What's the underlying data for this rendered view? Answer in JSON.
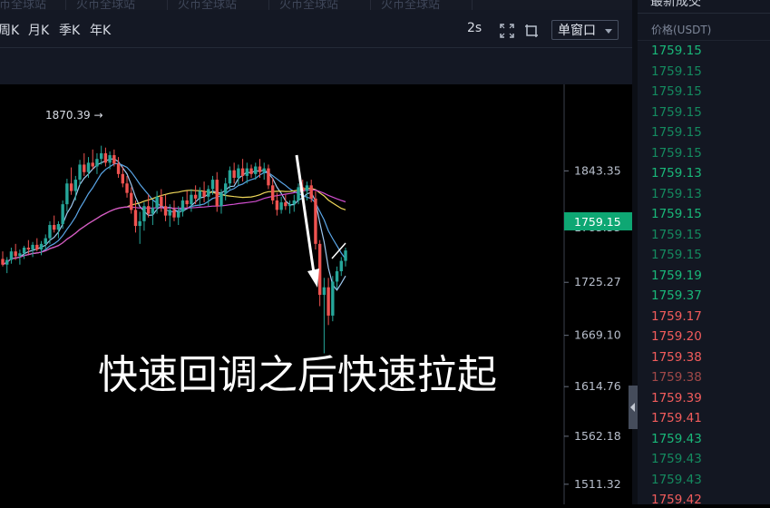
{
  "top_tabs": [
    "火币全球站",
    "火币全球站",
    "火币全球站",
    "火币全球站",
    "火币全球站"
  ],
  "toolbar": {
    "periods": [
      "周K",
      "月K",
      "季K",
      "年K"
    ],
    "interval": "2s",
    "window_select": "单窗口"
  },
  "chart": {
    "overlay_text": "快速回调之后快速拉起",
    "high_marker": "1870.39",
    "current_price": "1759.15",
    "y_ticks": [
      "1843.35",
      "1783.33",
      "1725.27",
      "1669.10",
      "1614.76",
      "1562.18",
      "1511.32"
    ]
  },
  "chart_data": {
    "type": "candlestick",
    "y_ticks": [
      1843.35,
      1783.33,
      1725.27,
      1669.1,
      1614.76,
      1562.18,
      1511.32
    ],
    "ylim": [
      1490,
      1935
    ],
    "high_label": 1870.39,
    "last_price": 1759.15,
    "up_color": "#26a69a",
    "down_color": "#ef5350",
    "candles": [
      [
        1750,
        1758,
        1742,
        1744
      ],
      [
        1744,
        1752,
        1735,
        1749
      ],
      [
        1749,
        1762,
        1745,
        1758
      ],
      [
        1758,
        1766,
        1749,
        1753
      ],
      [
        1753,
        1760,
        1744,
        1756
      ],
      [
        1756,
        1764,
        1750,
        1762
      ],
      [
        1762,
        1770,
        1755,
        1760
      ],
      [
        1760,
        1768,
        1752,
        1765
      ],
      [
        1765,
        1772,
        1758,
        1760
      ],
      [
        1760,
        1769,
        1754,
        1766
      ],
      [
        1766,
        1776,
        1760,
        1772
      ],
      [
        1772,
        1790,
        1766,
        1786
      ],
      [
        1786,
        1796,
        1778,
        1781
      ],
      [
        1781,
        1790,
        1772,
        1787
      ],
      [
        1787,
        1812,
        1782,
        1808
      ],
      [
        1808,
        1835,
        1800,
        1830
      ],
      [
        1830,
        1847,
        1818,
        1822
      ],
      [
        1822,
        1838,
        1812,
        1834
      ],
      [
        1834,
        1855,
        1828,
        1850
      ],
      [
        1850,
        1862,
        1838,
        1842
      ],
      [
        1842,
        1858,
        1836,
        1852
      ],
      [
        1852,
        1866,
        1845,
        1848
      ],
      [
        1848,
        1862,
        1840,
        1856
      ],
      [
        1856,
        1870,
        1850,
        1862
      ],
      [
        1862,
        1868,
        1848,
        1852
      ],
      [
        1852,
        1864,
        1845,
        1860
      ],
      [
        1860,
        1866,
        1848,
        1851
      ],
      [
        1851,
        1858,
        1836,
        1840
      ],
      [
        1840,
        1848,
        1826,
        1830
      ],
      [
        1830,
        1838,
        1815,
        1820
      ],
      [
        1820,
        1826,
        1798,
        1802
      ],
      [
        1802,
        1812,
        1778,
        1785
      ],
      [
        1785,
        1800,
        1766,
        1790
      ],
      [
        1790,
        1810,
        1780,
        1806
      ],
      [
        1806,
        1818,
        1794,
        1798
      ],
      [
        1798,
        1812,
        1786,
        1804
      ],
      [
        1804,
        1822,
        1798,
        1816
      ],
      [
        1816,
        1824,
        1800,
        1806
      ],
      [
        1806,
        1818,
        1790,
        1796
      ],
      [
        1796,
        1808,
        1784,
        1802
      ],
      [
        1802,
        1812,
        1790,
        1794
      ],
      [
        1794,
        1806,
        1786,
        1800
      ],
      [
        1800,
        1816,
        1795,
        1812
      ],
      [
        1812,
        1822,
        1804,
        1808
      ],
      [
        1808,
        1824,
        1800,
        1818
      ],
      [
        1818,
        1828,
        1808,
        1814
      ],
      [
        1814,
        1826,
        1806,
        1822
      ],
      [
        1822,
        1832,
        1810,
        1816
      ],
      [
        1816,
        1828,
        1806,
        1824
      ],
      [
        1824,
        1838,
        1818,
        1834
      ],
      [
        1834,
        1842,
        1800,
        1806
      ],
      [
        1806,
        1824,
        1798,
        1820
      ],
      [
        1820,
        1836,
        1812,
        1830
      ],
      [
        1830,
        1848,
        1824,
        1844
      ],
      [
        1844,
        1852,
        1830,
        1836
      ],
      [
        1836,
        1850,
        1828,
        1846
      ],
      [
        1846,
        1856,
        1832,
        1838
      ],
      [
        1838,
        1852,
        1830,
        1846
      ],
      [
        1846,
        1850,
        1836,
        1840
      ],
      [
        1840,
        1852,
        1834,
        1848
      ],
      [
        1848,
        1856,
        1836,
        1842
      ],
      [
        1842,
        1852,
        1834,
        1846
      ],
      [
        1846,
        1850,
        1824,
        1828
      ],
      [
        1828,
        1836,
        1808,
        1812
      ],
      [
        1812,
        1820,
        1796,
        1802
      ],
      [
        1802,
        1816,
        1798,
        1810
      ],
      [
        1810,
        1818,
        1802,
        1806
      ],
      [
        1806,
        1812,
        1798,
        1808
      ],
      [
        1808,
        1818,
        1800,
        1812
      ],
      [
        1812,
        1830,
        1808,
        1826
      ],
      [
        1826,
        1834,
        1818,
        1822
      ],
      [
        1822,
        1832,
        1812,
        1828
      ],
      [
        1828,
        1834,
        1810,
        1814
      ],
      [
        1814,
        1822,
        1760,
        1766
      ],
      [
        1766,
        1770,
        1700,
        1712
      ],
      [
        1712,
        1730,
        1650,
        1720
      ],
      [
        1720,
        1730,
        1680,
        1690
      ],
      [
        1690,
        1732,
        1684,
        1726
      ],
      [
        1726,
        1742,
        1718,
        1737
      ],
      [
        1737,
        1752,
        1732,
        1748
      ],
      [
        1748,
        1762,
        1742,
        1759
      ]
    ]
  },
  "sidebar": {
    "title": "最新成交",
    "column_header": "价格(USDT)",
    "rows": [
      {
        "price": "1759.15",
        "dir": "up"
      },
      {
        "price": "1759.15",
        "dir": "up-dim"
      },
      {
        "price": "1759.15",
        "dir": "up-dim"
      },
      {
        "price": "1759.15",
        "dir": "up-dim"
      },
      {
        "price": "1759.15",
        "dir": "up-dim"
      },
      {
        "price": "1759.15",
        "dir": "up-dim"
      },
      {
        "price": "1759.13",
        "dir": "up"
      },
      {
        "price": "1759.13",
        "dir": "up-dim"
      },
      {
        "price": "1759.15",
        "dir": "up"
      },
      {
        "price": "1759.15",
        "dir": "up-dim"
      },
      {
        "price": "1759.15",
        "dir": "up-dim"
      },
      {
        "price": "1759.19",
        "dir": "up"
      },
      {
        "price": "1759.37",
        "dir": "up"
      },
      {
        "price": "1759.17",
        "dir": "dn"
      },
      {
        "price": "1759.20",
        "dir": "dn"
      },
      {
        "price": "1759.38",
        "dir": "dn"
      },
      {
        "price": "1759.38",
        "dir": "dn-dim"
      },
      {
        "price": "1759.39",
        "dir": "dn"
      },
      {
        "price": "1759.41",
        "dir": "dn"
      },
      {
        "price": "1759.43",
        "dir": "up"
      },
      {
        "price": "1759.43",
        "dir": "up-dim"
      },
      {
        "price": "1759.43",
        "dir": "up-dim"
      },
      {
        "price": "1759.42",
        "dir": "dn"
      }
    ]
  }
}
